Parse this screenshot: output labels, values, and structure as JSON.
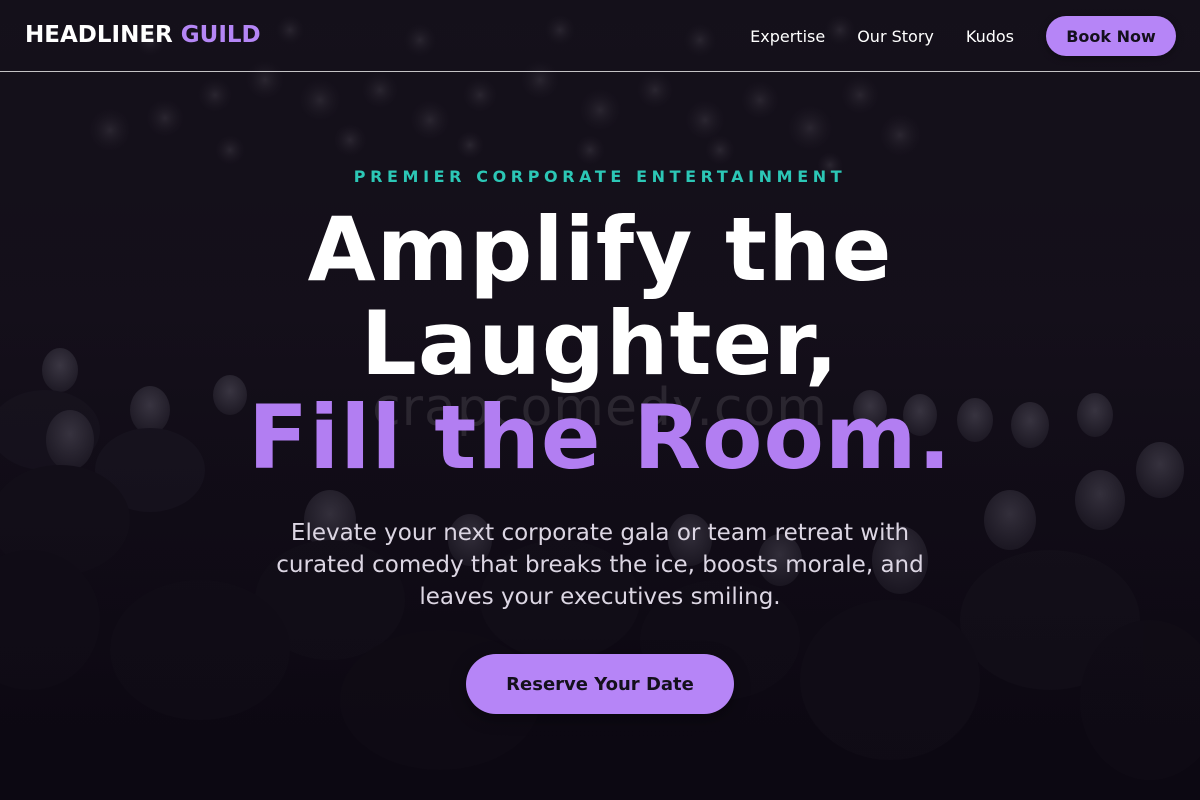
{
  "brand": {
    "name_part1": "HEADLINER",
    "name_part2": "GUILD",
    "accent_color": "#b486f5"
  },
  "nav": {
    "links": [
      {
        "label": "Expertise"
      },
      {
        "label": "Our Story"
      },
      {
        "label": "Kudos"
      }
    ],
    "cta_label": "Book Now"
  },
  "hero": {
    "eyebrow": "PREMIER CORPORATE ENTERTAINMENT",
    "headline_line1": "Amplify the",
    "headline_line2": "Laughter,",
    "headline_line3": "Fill the Room.",
    "subtext": "Elevate your next corporate gala or team retreat with curated comedy that breaks the ice, boosts morale, and leaves your executives smiling.",
    "cta_label": "Reserve Your Date",
    "watermark": "crapcomedy.com",
    "background": "audience-photo"
  },
  "colors": {
    "accent_purple": "#b685f7",
    "eyebrow_teal": "#2cc7b6",
    "background_dark": "#0b0812"
  }
}
